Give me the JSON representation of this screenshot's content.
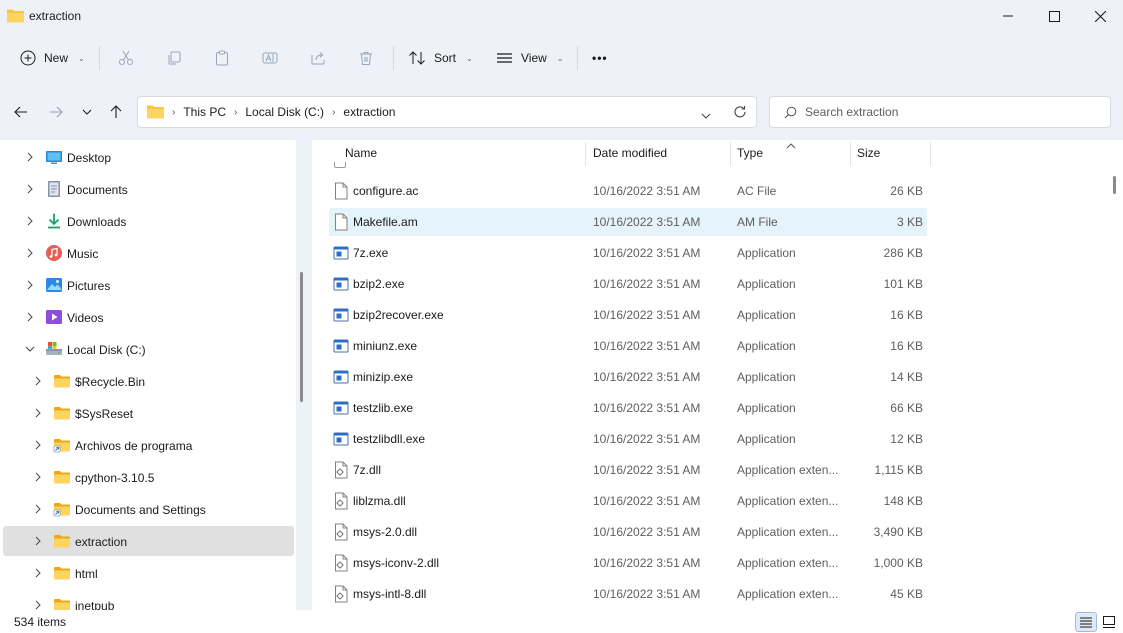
{
  "window": {
    "title": "extraction",
    "buttons": [
      "minimize",
      "maximize",
      "close"
    ]
  },
  "toolbar": {
    "new_label": "New",
    "sort_label": "Sort",
    "view_label": "View",
    "more_label": "•••"
  },
  "address": {
    "crumbs": [
      "This PC",
      "Local Disk (C:)",
      "extraction"
    ]
  },
  "search": {
    "placeholder": "Search extraction"
  },
  "sidebar": {
    "items": [
      {
        "label": "Desktop",
        "icon": "desktop-icon",
        "level": 0,
        "expanded": false
      },
      {
        "label": "Documents",
        "icon": "documents-icon",
        "level": 0,
        "expanded": false
      },
      {
        "label": "Downloads",
        "icon": "downloads-icon",
        "level": 0,
        "expanded": false
      },
      {
        "label": "Music",
        "icon": "music-icon",
        "level": 0,
        "expanded": false
      },
      {
        "label": "Pictures",
        "icon": "pictures-icon",
        "level": 0,
        "expanded": false
      },
      {
        "label": "Videos",
        "icon": "videos-icon",
        "level": 0,
        "expanded": false
      },
      {
        "label": "Local Disk (C:)",
        "icon": "drive-icon",
        "level": 0,
        "expanded": true
      },
      {
        "label": "$Recycle.Bin",
        "icon": "folder-icon",
        "level": 1,
        "expanded": false
      },
      {
        "label": "$SysReset",
        "icon": "folder-icon",
        "level": 1,
        "expanded": false
      },
      {
        "label": "Archivos de programa",
        "icon": "folder-shortcut-icon",
        "level": 1,
        "expanded": false
      },
      {
        "label": "cpython-3.10.5",
        "icon": "folder-icon",
        "level": 1,
        "expanded": false
      },
      {
        "label": "Documents and Settings",
        "icon": "folder-shortcut-icon",
        "level": 1,
        "expanded": false
      },
      {
        "label": "extraction",
        "icon": "folder-icon",
        "level": 1,
        "expanded": false,
        "selected": true
      },
      {
        "label": "html",
        "icon": "folder-icon",
        "level": 1,
        "expanded": false
      },
      {
        "label": "inetpub",
        "icon": "folder-icon",
        "level": 1,
        "expanded": false
      }
    ]
  },
  "columns": {
    "name": "Name",
    "date": "Date modified",
    "type": "Type",
    "size": "Size"
  },
  "files": [
    {
      "name": "configure.ac",
      "date": "10/16/2022 3:51 AM",
      "type": "AC File",
      "size": "26 KB",
      "kind": "file"
    },
    {
      "name": "Makefile.am",
      "date": "10/16/2022 3:51 AM",
      "type": "AM File",
      "size": "3 KB",
      "kind": "file",
      "highlight": true
    },
    {
      "name": "7z.exe",
      "date": "10/16/2022 3:51 AM",
      "type": "Application",
      "size": "286 KB",
      "kind": "exe"
    },
    {
      "name": "bzip2.exe",
      "date": "10/16/2022 3:51 AM",
      "type": "Application",
      "size": "101 KB",
      "kind": "exe"
    },
    {
      "name": "bzip2recover.exe",
      "date": "10/16/2022 3:51 AM",
      "type": "Application",
      "size": "16 KB",
      "kind": "exe"
    },
    {
      "name": "miniunz.exe",
      "date": "10/16/2022 3:51 AM",
      "type": "Application",
      "size": "16 KB",
      "kind": "exe"
    },
    {
      "name": "minizip.exe",
      "date": "10/16/2022 3:51 AM",
      "type": "Application",
      "size": "14 KB",
      "kind": "exe"
    },
    {
      "name": "testzlib.exe",
      "date": "10/16/2022 3:51 AM",
      "type": "Application",
      "size": "66 KB",
      "kind": "exe"
    },
    {
      "name": "testzlibdll.exe",
      "date": "10/16/2022 3:51 AM",
      "type": "Application",
      "size": "12 KB",
      "kind": "exe"
    },
    {
      "name": "7z.dll",
      "date": "10/16/2022 3:51 AM",
      "type": "Application exten...",
      "size": "1,115 KB",
      "kind": "dll"
    },
    {
      "name": "liblzma.dll",
      "date": "10/16/2022 3:51 AM",
      "type": "Application exten...",
      "size": "148 KB",
      "kind": "dll"
    },
    {
      "name": "msys-2.0.dll",
      "date": "10/16/2022 3:51 AM",
      "type": "Application exten...",
      "size": "3,490 KB",
      "kind": "dll"
    },
    {
      "name": "msys-iconv-2.dll",
      "date": "10/16/2022 3:51 AM",
      "type": "Application exten...",
      "size": "1,000 KB",
      "kind": "dll"
    },
    {
      "name": "msys-intl-8.dll",
      "date": "10/16/2022 3:51 AM",
      "type": "Application exten...",
      "size": "45 KB",
      "kind": "dll"
    }
  ],
  "status": {
    "item_count": "534 items"
  },
  "colors": {
    "selected_row": "#e5f3fb",
    "sidebar_selected": "#e0e0e0",
    "folder_yellow": "#f8c640",
    "accent": "#0067c0"
  }
}
